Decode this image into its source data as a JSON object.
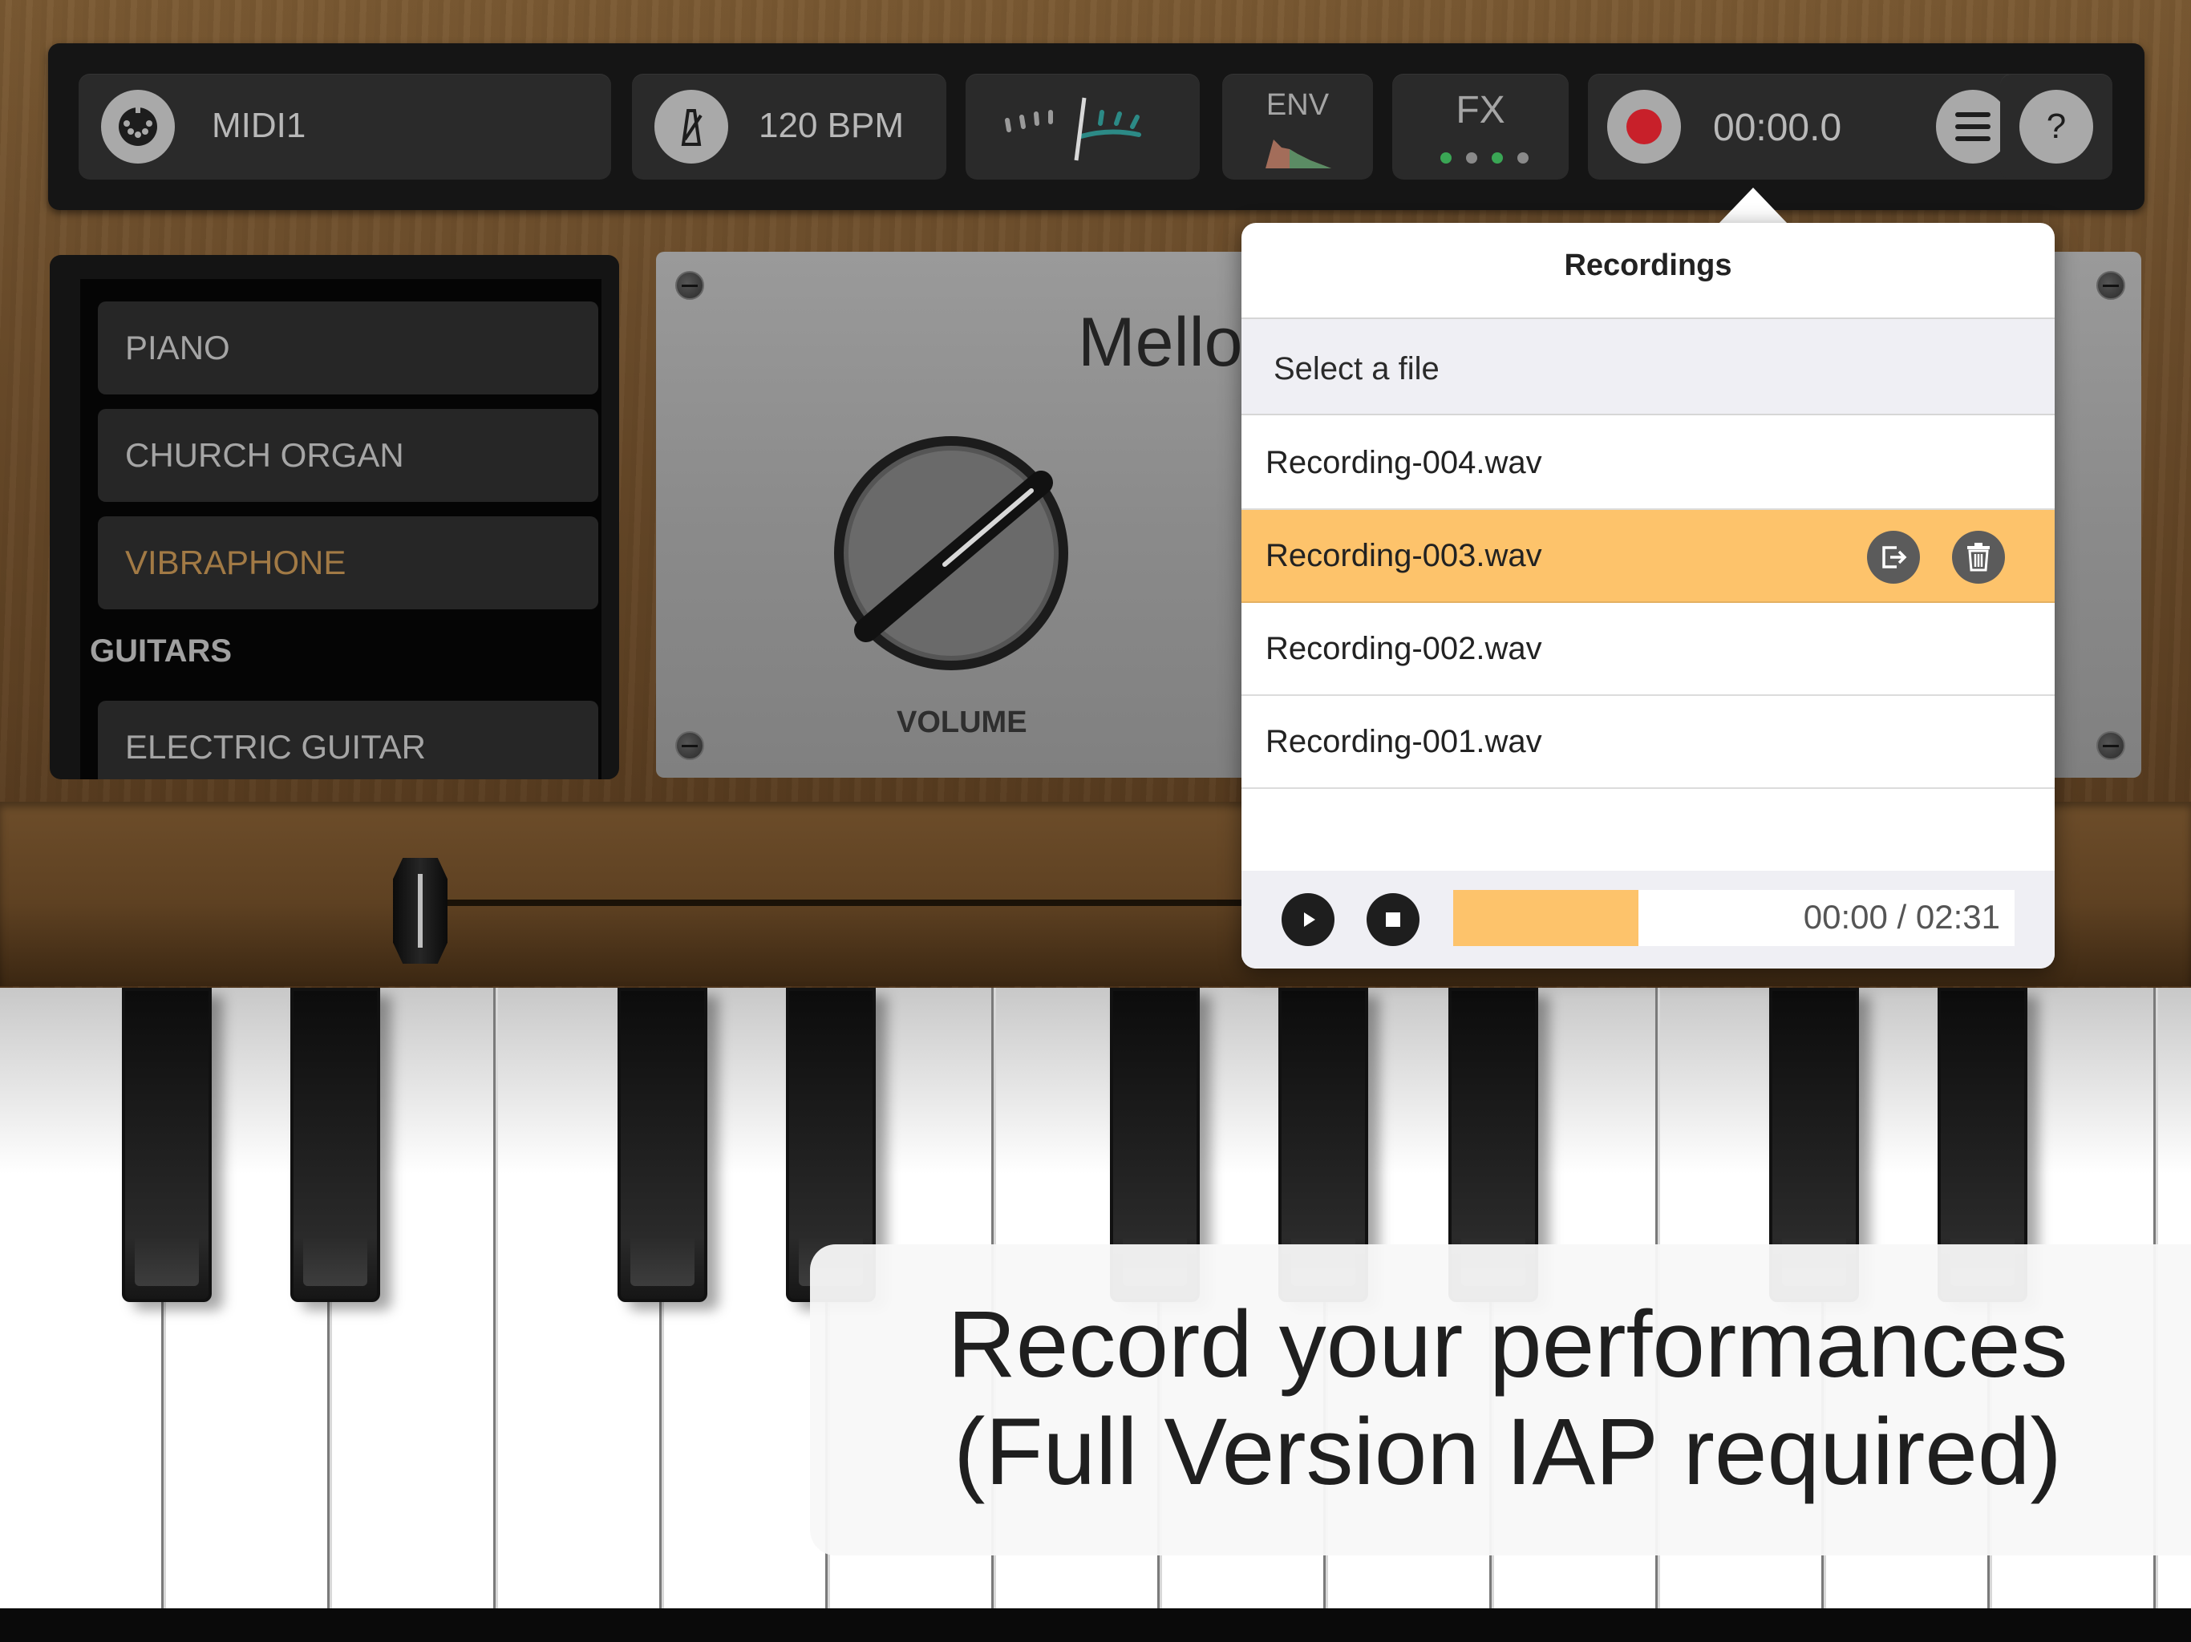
{
  "toolbar": {
    "midi_label": "MIDI1",
    "tempo_label": "120 BPM",
    "env_label": "ENV",
    "fx_label": "FX",
    "fx_dots": [
      "#3aa655",
      "#8a8a8a",
      "#3aa655",
      "#8a8a8a"
    ],
    "record_time": "00:00.0",
    "help_label": "?"
  },
  "categories": {
    "items": [
      "PIANO",
      "CHURCH ORGAN",
      "VIBRAPHONE"
    ],
    "selected": "VIBRAPHONE",
    "section_header": "GUITARS",
    "section_items": [
      "ELECTRIC GUITAR"
    ]
  },
  "instrument": {
    "name_partial": "Mello",
    "volume_label": "VOLUME"
  },
  "recordings": {
    "title": "Recordings",
    "subtitle": "Select a file",
    "files": [
      "Recording-004.wav",
      "Recording-003.wav",
      "Recording-002.wav",
      "Recording-001.wav"
    ],
    "selected_file": "Recording-003.wav",
    "player": {
      "elapsed": "00:00",
      "separator": "/",
      "total": "02:31",
      "progress_fraction": 0.33
    }
  },
  "caption": {
    "line1": "Record your performances",
    "line2": "(Full Version IAP required)"
  },
  "colors": {
    "accent": "#fdc36b",
    "record": "#c8202a",
    "selected_category_text": "#a27a45",
    "wood": "#6c4d2b"
  }
}
